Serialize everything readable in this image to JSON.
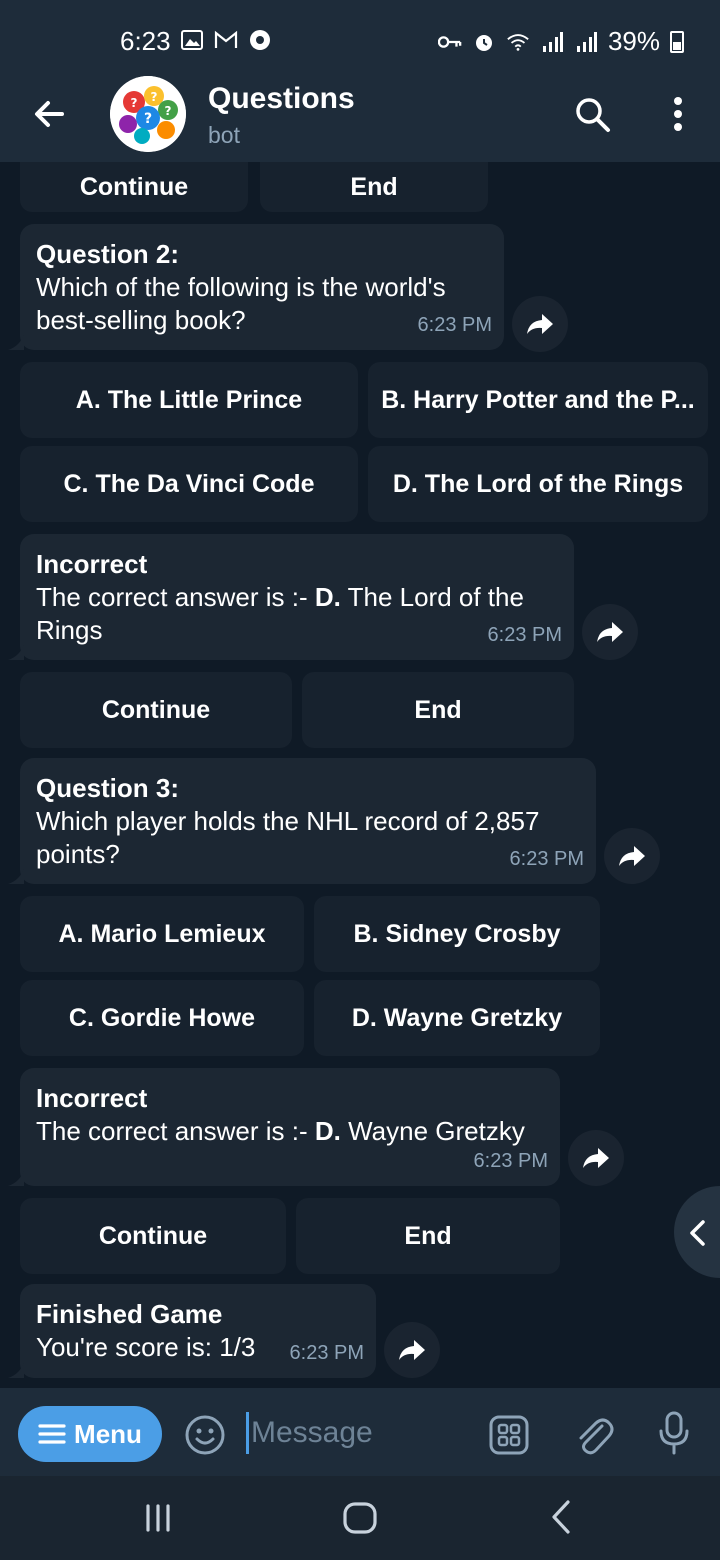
{
  "status_bar": {
    "time": "6:23",
    "battery_text": "39%"
  },
  "header": {
    "title": "Questions",
    "subtitle": "bot"
  },
  "chat": {
    "top_buttons": [
      "Continue",
      "End"
    ],
    "q2": {
      "heading": "Question 2:",
      "text": "Which of the following is the world's best-selling book?",
      "time": "6:23 PM",
      "options": [
        "A. The Little Prince",
        "B. Harry Potter and the P...",
        "C. The Da Vinci Code",
        "D. The Lord of the Rings"
      ]
    },
    "result2": {
      "heading": "Incorrect",
      "text_prefix": "The correct answer is :- ",
      "answer": "D.",
      "text_suffix": " The Lord of the Rings",
      "time": "6:23 PM",
      "buttons": [
        "Continue",
        "End"
      ]
    },
    "q3": {
      "heading": "Question 3:",
      "text": "Which player holds the NHL record of 2,857 points?",
      "time": "6:23 PM",
      "options": [
        "A. Mario Lemieux",
        "B. Sidney Crosby",
        "C. Gordie Howe",
        "D. Wayne Gretzky"
      ]
    },
    "result3": {
      "heading": "Incorrect",
      "text_prefix": "The correct answer is :- ",
      "answer": "D.",
      "text_suffix": " Wayne Gretzky",
      "time": "6:23 PM",
      "buttons": [
        "Continue",
        "End"
      ]
    },
    "final": {
      "heading": "Finished Game",
      "text": "You're score is: 1/3",
      "time": "6:23 PM"
    }
  },
  "input_bar": {
    "menu_label": "Menu",
    "placeholder": "Message"
  },
  "colors": {
    "accent": "#4b9ee6",
    "bubble": "#1c2733",
    "background": "#0f1a26",
    "header": "#1e2c3a"
  }
}
